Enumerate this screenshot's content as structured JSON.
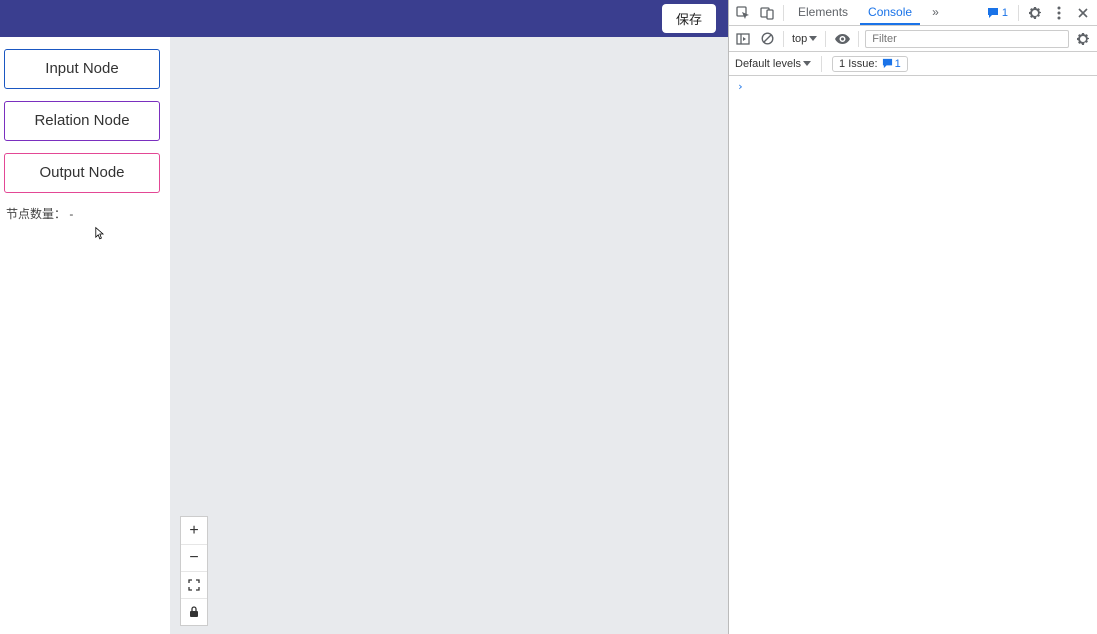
{
  "topbar": {
    "save_label": "保存"
  },
  "sidebar": {
    "nodes": {
      "input_label": "Input Node",
      "relation_label": "Relation Node",
      "output_label": "Output Node"
    },
    "count_label": "节点数量：",
    "count_value": "-"
  },
  "zoom": {
    "in": "+",
    "out": "−"
  },
  "devtools": {
    "tabs": {
      "elements": "Elements",
      "console": "Console",
      "more": "»"
    },
    "messages_count": "1",
    "toolbar": {
      "context_label": "top",
      "filter_placeholder": "Filter"
    },
    "levels": {
      "label": "Default levels"
    },
    "issues": {
      "label": "1 Issue:",
      "count": "1"
    },
    "prompt": "›"
  }
}
